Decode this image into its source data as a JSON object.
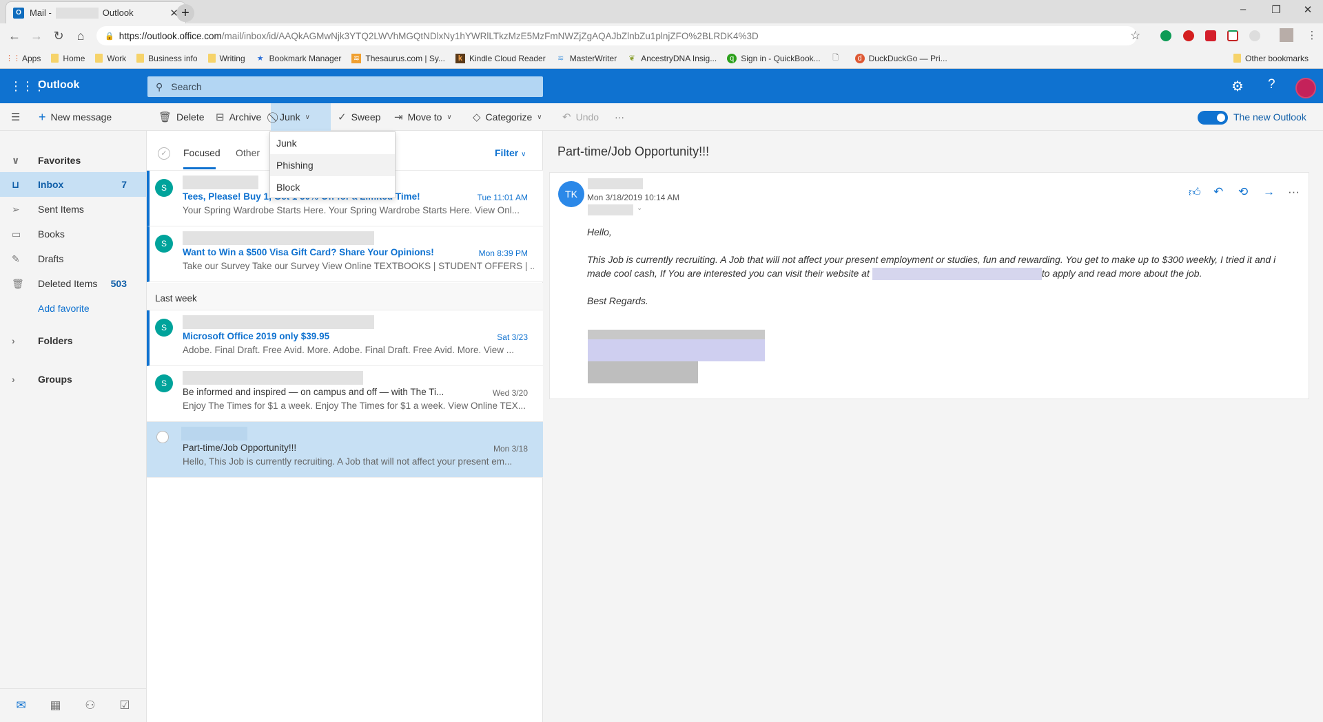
{
  "browser": {
    "tab_title_prefix": "Mail -",
    "tab_title_suffix": "Outlook",
    "url_host": "https://outlook.office.com",
    "url_path": "/mail/inbox/id/AAQkAGMwNjk3YTQ2LWVhMGQtNDlxNy1hYWRlLTkzMzE5MzFmNWZjZgAQAJbZlnbZu1plnjZFO%2BLRDK4%3D",
    "bookmarks": [
      {
        "label": "Apps",
        "icon": "apps-grid-icon"
      },
      {
        "label": "Home",
        "icon": "folder-icon"
      },
      {
        "label": "Work",
        "icon": "folder-icon"
      },
      {
        "label": "Business info",
        "icon": "folder-icon"
      },
      {
        "label": "Writing",
        "icon": "folder-icon"
      },
      {
        "label": "Bookmark Manager",
        "icon": "star-icon"
      },
      {
        "label": "Thesaurus.com | Sy...",
        "icon": "thesaurus-icon"
      },
      {
        "label": "Kindle Cloud Reader",
        "icon": "kindle-icon"
      },
      {
        "label": "MasterWriter",
        "icon": "masterwriter-icon"
      },
      {
        "label": "AncestryDNA Insig...",
        "icon": "ancestry-icon"
      },
      {
        "label": "Sign in - QuickBook...",
        "icon": "quickbooks-icon"
      },
      {
        "label": "",
        "icon": "page-icon"
      },
      {
        "label": "DuckDuckGo — Pri...",
        "icon": "duckduckgo-icon"
      }
    ],
    "other_bookmarks": "Other bookmarks"
  },
  "header": {
    "app_name": "Outlook",
    "search_placeholder": "Search"
  },
  "toolbar": {
    "new_message": "New message",
    "delete": "Delete",
    "archive": "Archive",
    "junk": "Junk",
    "sweep": "Sweep",
    "move_to": "Move to",
    "categorize": "Categorize",
    "undo": "Undo",
    "more": "···",
    "new_outlook_label": "The new Outlook",
    "new_outlook_on": true
  },
  "junk_menu": {
    "items": [
      "Junk",
      "Phishing",
      "Block"
    ],
    "hovered": "Phishing"
  },
  "sidebar": {
    "favorites": "Favorites",
    "items": [
      {
        "label": "Inbox",
        "count": "7",
        "icon": "inbox-icon"
      },
      {
        "label": "Sent Items",
        "count": "",
        "icon": "send-icon"
      },
      {
        "label": "Books",
        "count": "",
        "icon": "folder-icon"
      },
      {
        "label": "Drafts",
        "count": "",
        "icon": "pencil-icon"
      },
      {
        "label": "Deleted Items",
        "count": "503",
        "icon": "trash-icon"
      }
    ],
    "add_favorite": "Add favorite",
    "folders": "Folders",
    "groups": "Groups"
  },
  "list": {
    "tab_focused": "Focused",
    "tab_other": "Other",
    "filter": "Filter",
    "group_last_week": "Last week",
    "messages": [
      {
        "avatar": "S",
        "subject": "Tees, Please! Buy 1, Get 1 50% Off for a Limited Time!",
        "date": "Tue 11:01 AM",
        "preview": "Your Spring Wardrobe Starts Here. Your Spring Wardrobe Starts Here. View Onl...",
        "unread": true
      },
      {
        "avatar": "S",
        "subject": "Want to Win a $500 Visa Gift Card? Share Your Opinions!",
        "date": "Mon 8:39 PM",
        "preview": "Take our Survey Take our Survey View Online TEXTBOOKS | STUDENT OFFERS | ...",
        "unread": true
      },
      {
        "avatar": "S",
        "subject": "Microsoft Office 2019 only $39.95",
        "date": "Sat 3/23",
        "preview": "Adobe. Final Draft. Free Avid. More. Adobe. Final Draft. Free Avid. More. View ...",
        "unread": true
      },
      {
        "avatar": "S",
        "subject": "Be informed and inspired — on campus and off — with The Ti...",
        "date": "Wed 3/20",
        "preview": "Enjoy The Times for $1 a week. Enjoy The Times for $1 a week. View Online TEX...",
        "unread": false
      },
      {
        "avatar": "",
        "subject": "Part-time/Job Opportunity!!!",
        "date": "Mon 3/18",
        "preview": "Hello, This Job is currently recruiting. A Job that will not affect your present em...",
        "unread": false,
        "selected": true
      }
    ]
  },
  "reading": {
    "subject": "Part-time/Job Opportunity!!!",
    "sender_initials": "TK",
    "sent": "Mon 3/18/2019 10:14 AM",
    "greeting": "Hello,",
    "body_line1": "This Job is currently recruiting.  A Job that will not affect your present employment or studies, fun and rewarding.  You get to make up to $300 weekly, I tried it and i made cool cash, If You are interested you can visit their website at",
    "body_line1_end": "to apply and read more about the job.",
    "closing": "Best Regards."
  }
}
